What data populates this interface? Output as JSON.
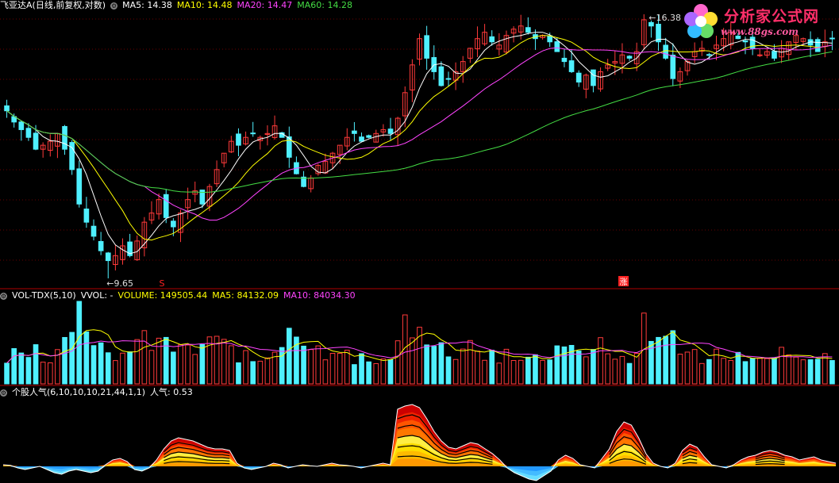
{
  "header": {
    "stock_title": "飞亚达A(日线,前复权,对数)",
    "ma": [
      {
        "label": "MA5: 14.38",
        "color": "#ffffff"
      },
      {
        "label": "MA10: 14.48",
        "color": "#ffff00"
      },
      {
        "label": "MA20: 14.47",
        "color": "#ff44ff"
      },
      {
        "label": "MA60: 14.28",
        "color": "#44dd44"
      }
    ]
  },
  "vol_header": {
    "name": "VOL-TDX(5,10)",
    "vvol": "VVOL: -",
    "volume": "VOLUME: 149505.44",
    "ma5": "MA5: 84132.09",
    "ma10": "MA10: 84034.30"
  },
  "pop_header": {
    "name": "个股人气(6,10,10,10,21,44,1,1)",
    "value": "人气: 0.53"
  },
  "logo": {
    "title": "分析家公式网",
    "url": "www.88gs.com"
  },
  "annotations": {
    "high": "16.38",
    "low": "9.65",
    "marker_s": "S",
    "marker_zhang": "涨"
  },
  "colors": {
    "up": "#ff3a3a",
    "down": "#4ff0ff",
    "ma5": "#ffffff",
    "ma10": "#ffff00",
    "ma20": "#ff44ff",
    "ma60": "#44dd44",
    "divider": "#b00000"
  },
  "chart_data": [
    {
      "type": "candlestick",
      "title": "飞亚达A(日线,前复权,对数)",
      "ylim": [
        9.65,
        16.38
      ],
      "scale": "log",
      "close": [
        13.5,
        13.2,
        13.0,
        12.8,
        12.5,
        12.6,
        12.7,
        12.9,
        12.5,
        12.0,
        11.2,
        10.8,
        10.5,
        10.2,
        10.0,
        10.1,
        10.3,
        10.1,
        10.4,
        10.8,
        11.0,
        11.3,
        10.9,
        10.7,
        11.0,
        11.3,
        11.5,
        11.2,
        11.6,
        12.0,
        12.4,
        12.7,
        12.6,
        12.8,
        12.9,
        12.8,
        12.9,
        13.1,
        12.8,
        12.3,
        11.9,
        11.6,
        11.8,
        12.1,
        12.2,
        12.4,
        12.6,
        12.8,
        12.9,
        12.7,
        12.8,
        12.9,
        13.0,
        12.9,
        13.3,
        14.0,
        14.8,
        15.6,
        15.0,
        14.6,
        14.2,
        14.4,
        14.6,
        14.9,
        15.3,
        15.6,
        15.8,
        15.5,
        15.4,
        15.7,
        15.9,
        16.0,
        15.8,
        15.6,
        15.7,
        15.5,
        15.2,
        14.9,
        14.6,
        14.3,
        14.5,
        14.2,
        14.6,
        14.8,
        14.9,
        15.1,
        15.0,
        15.2,
        16.2,
        16.0,
        15.5,
        15.0,
        14.4,
        14.6,
        14.9,
        15.2,
        15.3,
        15.1,
        15.4,
        15.6,
        15.8,
        15.6,
        15.5,
        15.3,
        15.1,
        15.2,
        15.0,
        15.3,
        15.5,
        15.7,
        15.6,
        15.4,
        15.2,
        15.5,
        15.6
      ]
    },
    {
      "type": "bar",
      "title": "VOL-TDX(5,10)",
      "series": [
        {
          "name": "VOLUME",
          "last": 149505.44
        },
        {
          "name": "MA5",
          "last": 84132.09
        },
        {
          "name": "MA10",
          "last": 84034.3
        }
      ]
    },
    {
      "type": "area",
      "title": "个股人气(6,10,10,10,21,44,1,1)",
      "series": [
        {
          "name": "人气",
          "last": 0.53
        }
      ],
      "values": [
        0.05,
        0.03,
        -0.05,
        -0.1,
        -0.05,
        0.0,
        -0.1,
        -0.2,
        -0.25,
        -0.15,
        -0.1,
        -0.15,
        -0.2,
        -0.15,
        0.05,
        0.2,
        0.25,
        0.15,
        -0.1,
        -0.15,
        -0.05,
        0.2,
        0.55,
        0.8,
        0.9,
        0.85,
        0.8,
        0.7,
        0.6,
        0.55,
        0.55,
        0.5,
        0.1,
        -0.05,
        -0.1,
        -0.05,
        0.0,
        0.1,
        0.05,
        -0.05,
        0.0,
        0.05,
        0.02,
        0.0,
        0.05,
        0.1,
        0.05,
        0.03,
        0.0,
        -0.05,
        0.0,
        0.05,
        0.1,
        0.05,
        1.8,
        1.9,
        1.95,
        1.85,
        1.5,
        1.1,
        0.8,
        0.6,
        0.55,
        0.65,
        0.75,
        0.7,
        0.55,
        0.4,
        0.2,
        -0.05,
        -0.2,
        -0.3,
        -0.4,
        -0.45,
        -0.3,
        -0.15,
        0.2,
        0.35,
        0.25,
        0.05,
        0.0,
        -0.05,
        0.25,
        0.55,
        1.1,
        1.4,
        1.3,
        0.9,
        0.4,
        0.1,
        0.0,
        -0.05,
        0.1,
        0.5,
        0.7,
        0.6,
        0.3,
        0.05,
        0.0,
        -0.05,
        0.05,
        0.2,
        0.3,
        0.35,
        0.45,
        0.5,
        0.45,
        0.35,
        0.3,
        0.2,
        0.25,
        0.3,
        0.2,
        0.15,
        0.1
      ]
    }
  ]
}
